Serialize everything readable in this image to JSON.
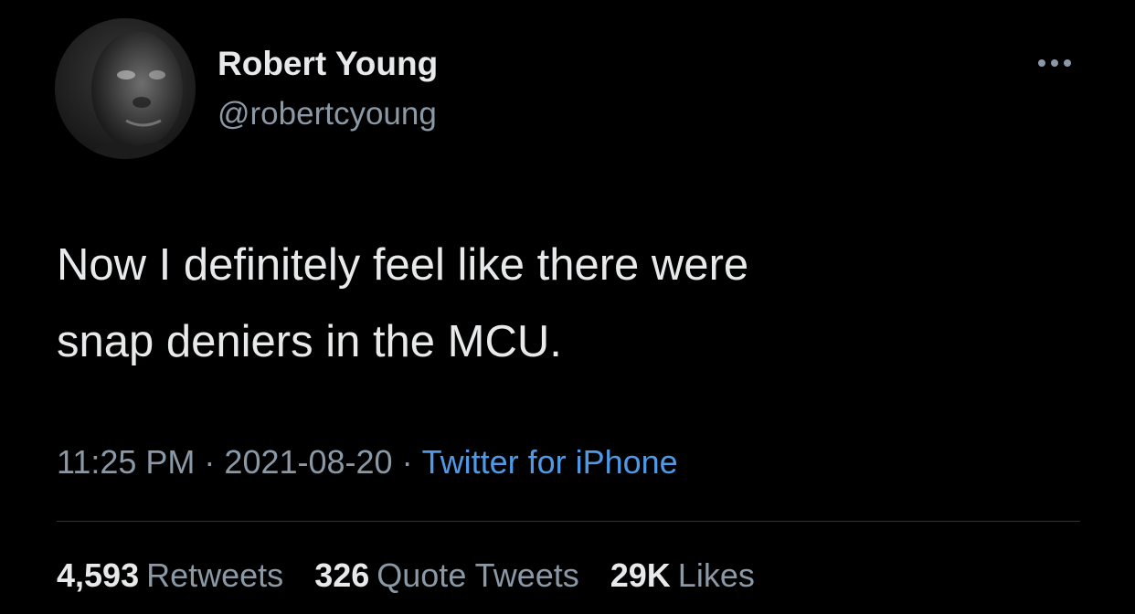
{
  "author": {
    "display_name": "Robert Young",
    "handle": "@robertcyoung",
    "avatar_icon": "profile-photo"
  },
  "more_icon": "ellipsis-icon",
  "tweet": {
    "text": "Now I definitely feel like there were\nsnap deniers in the MCU."
  },
  "meta": {
    "time": "11:25 PM",
    "separator": "·",
    "date": "2021-08-20",
    "source": "Twitter for iPhone"
  },
  "stats": {
    "retweets_count": "4,593",
    "retweets_label": "Retweets",
    "quotes_count": "326",
    "quotes_label": "Quote Tweets",
    "likes_count": "29K",
    "likes_label": "Likes"
  },
  "colors": {
    "background": "#000000",
    "primary_text": "#e7e9ea",
    "secondary_text": "#8b98a5",
    "link": "#4f99e6",
    "divider": "#2f3336"
  }
}
